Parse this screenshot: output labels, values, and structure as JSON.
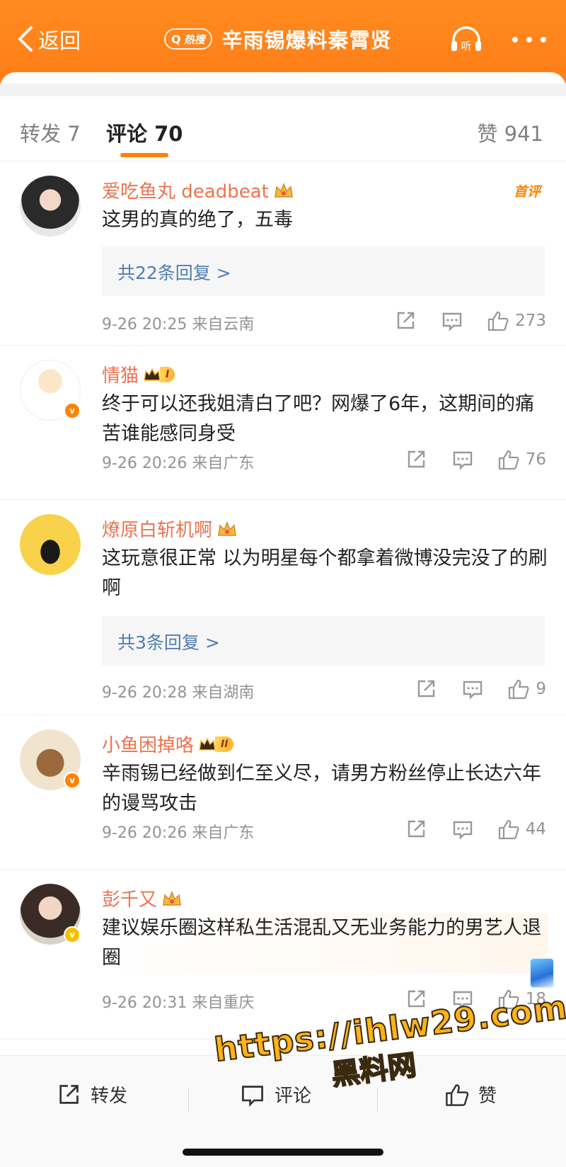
{
  "header": {
    "back_label": "返回",
    "hot_badge": "热搜",
    "title": "辛雨锡爆料秦霄贤",
    "listen_label": "听",
    "colors": {
      "bg": "#ff7d18",
      "text": "#ffffff"
    }
  },
  "tabs": {
    "repost": "转发 7",
    "comments": "评论 70",
    "likes": "赞 941"
  },
  "comments": [
    {
      "user": "爱吃鱼丸 deadbeat",
      "badge": "crown",
      "tag": "首评",
      "text": "这男的真的绝了，五毒",
      "replies": "共22条回复 >",
      "time": "9-26 20:25",
      "location": "来自云南",
      "likes": "273"
    },
    {
      "user": "情猫",
      "badge": "level",
      "level": "I",
      "text": "终于可以还我姐清白了吧？网爆了6年，这期间的痛苦谁能感同身受",
      "time": "9-26 20:26",
      "location": "来自广东",
      "likes": "76"
    },
    {
      "user": "燎原白斩机啊",
      "badge": "crown",
      "text": "这玩意很正常 以为明星每个都拿着微博没完没了的刷啊",
      "replies": "共3条回复 >",
      "time": "9-26 20:28",
      "location": "来自湖南",
      "likes": "9"
    },
    {
      "user": "小鱼困掉咯",
      "badge": "level",
      "level": "II",
      "text": "辛雨锡已经做到仁至义尽，请男方粉丝停止长达六年的谩骂攻击",
      "time": "9-26 20:26",
      "location": "来自广东",
      "likes": "44"
    },
    {
      "user": "彭千又",
      "badge": "crown",
      "text": "建议娱乐圈这样私生活混乱又无业务能力的男艺人退圈",
      "time": "9-26 20:31",
      "location": "来自重庆",
      "likes": "18"
    }
  ],
  "bottom_bar": {
    "repost": "转发",
    "comment": "评论",
    "like": "赞"
  },
  "watermark": {
    "line1": "https://ihlw29.com",
    "line2": "黑料网"
  },
  "icons": [
    "back-chevron-icon",
    "search-icon",
    "headphones-icon",
    "more-icon",
    "share-icon",
    "comment-icon",
    "thumbs-up-icon",
    "crown-icon",
    "verified-icon"
  ]
}
